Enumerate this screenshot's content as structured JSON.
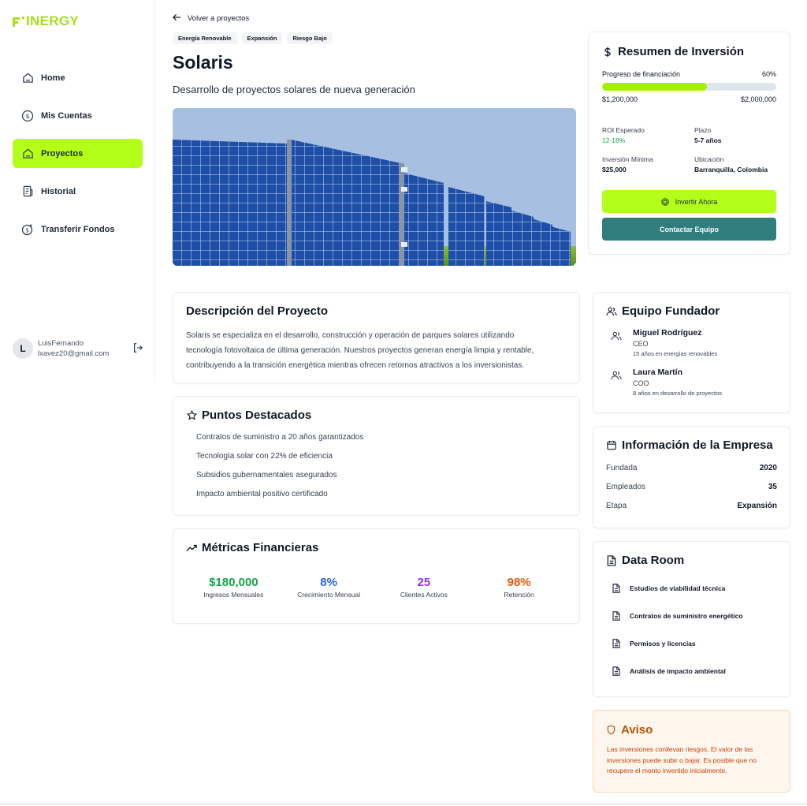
{
  "brand": {
    "logo_text": "INERGY",
    "accent": "#b3ff1a"
  },
  "sidebar": {
    "items": [
      {
        "label": "Home",
        "icon": "home-icon"
      },
      {
        "label": "Mis Cuentas",
        "icon": "dollar-circle-icon"
      },
      {
        "label": "Proyectos",
        "icon": "home-icon",
        "active": true
      },
      {
        "label": "Historial",
        "icon": "receipt-icon"
      },
      {
        "label": "Transferir Fondos",
        "icon": "dollar-transfer-icon"
      }
    ],
    "user": {
      "initial": "L",
      "name": "LuisFernando",
      "email": "lxavez20@gmail.com"
    }
  },
  "project": {
    "back_label": "Volver a proyectos",
    "tags": [
      "Energía Renovable",
      "Expansión",
      "Riesgo Bajo"
    ],
    "title": "Solaris",
    "subtitle": "Desarrollo de proyectos solares de nueva generación"
  },
  "description": {
    "title": "Descripción del Proyecto",
    "lines": [
      "Solaris se especializa en el desarrollo, construcción y operación de parques solares utilizando",
      "tecnología fotovoltaica de última generación. Nuestros proyectos generan energía limpia y rentable,",
      "contribuyendo a la transición energética mientras ofrecen retornos atractivos a los inversionistas."
    ]
  },
  "highlights": {
    "title": "Puntos Destacados",
    "items": [
      "Contratos de suministro a 20 años garantizados",
      "Tecnología solar con 22% de eficiencia",
      "Subsidios gubernamentales asegurados",
      "Impacto ambiental positivo certificado"
    ]
  },
  "metrics": {
    "title": "Métricas Financieras",
    "items": [
      {
        "value": "$180,000",
        "label": "Ingresos Mensuales",
        "color": "#16a34a"
      },
      {
        "value": "8%",
        "label": "Crecimiento Mensual",
        "color": "#2563eb"
      },
      {
        "value": "25",
        "label": "Clientes Activos",
        "color": "#9333ea"
      },
      {
        "value": "98%",
        "label": "Retención",
        "color": "#ea580c"
      }
    ]
  },
  "investment": {
    "title": "Resumen de Inversión",
    "progress_label": "Progreso de financiación",
    "progress_pct_label": "60%",
    "progress_fraction": 0.6,
    "raised": "$1,200,000",
    "goal": "$2,000,000",
    "roi_label": "ROI Esperado",
    "roi_value": "12-18%",
    "term_label": "Plazo",
    "term_value": "5-7 años",
    "min_label": "Inversión Mínima",
    "min_value": "$25,000",
    "location_label": "Ubicación",
    "location_value": "Barranquilla, Colombia",
    "invest_button": "Invertir Ahora",
    "contact_button": "Contactar Equipo"
  },
  "team": {
    "title": "Equipo Fundador",
    "members": [
      {
        "name": "Miguel Rodríguez",
        "role": "CEO",
        "exp": "15 años en energías renovables"
      },
      {
        "name": "Laura Martín",
        "role": "COO",
        "exp": "8 años en desarrollo de proyectos"
      }
    ]
  },
  "company": {
    "title": "Información de la Empresa",
    "rows": [
      {
        "label": "Fundada",
        "value": "2020"
      },
      {
        "label": "Empleados",
        "value": "35"
      },
      {
        "label": "Etapa",
        "value": "Expansión"
      }
    ]
  },
  "dataroom": {
    "title": "Data Room",
    "docs": [
      "Estudios de viabilidad técnica",
      "Contratos de suministro energético",
      "Permisos y licencias",
      "Análisis de impacto ambiental"
    ]
  },
  "notice": {
    "title": "Aviso",
    "text": "Las inversiones conllevan riesgos. El valor de las inversiones puede subir o bajar. Es posible que no recupere el monto invertido inicialmente."
  }
}
